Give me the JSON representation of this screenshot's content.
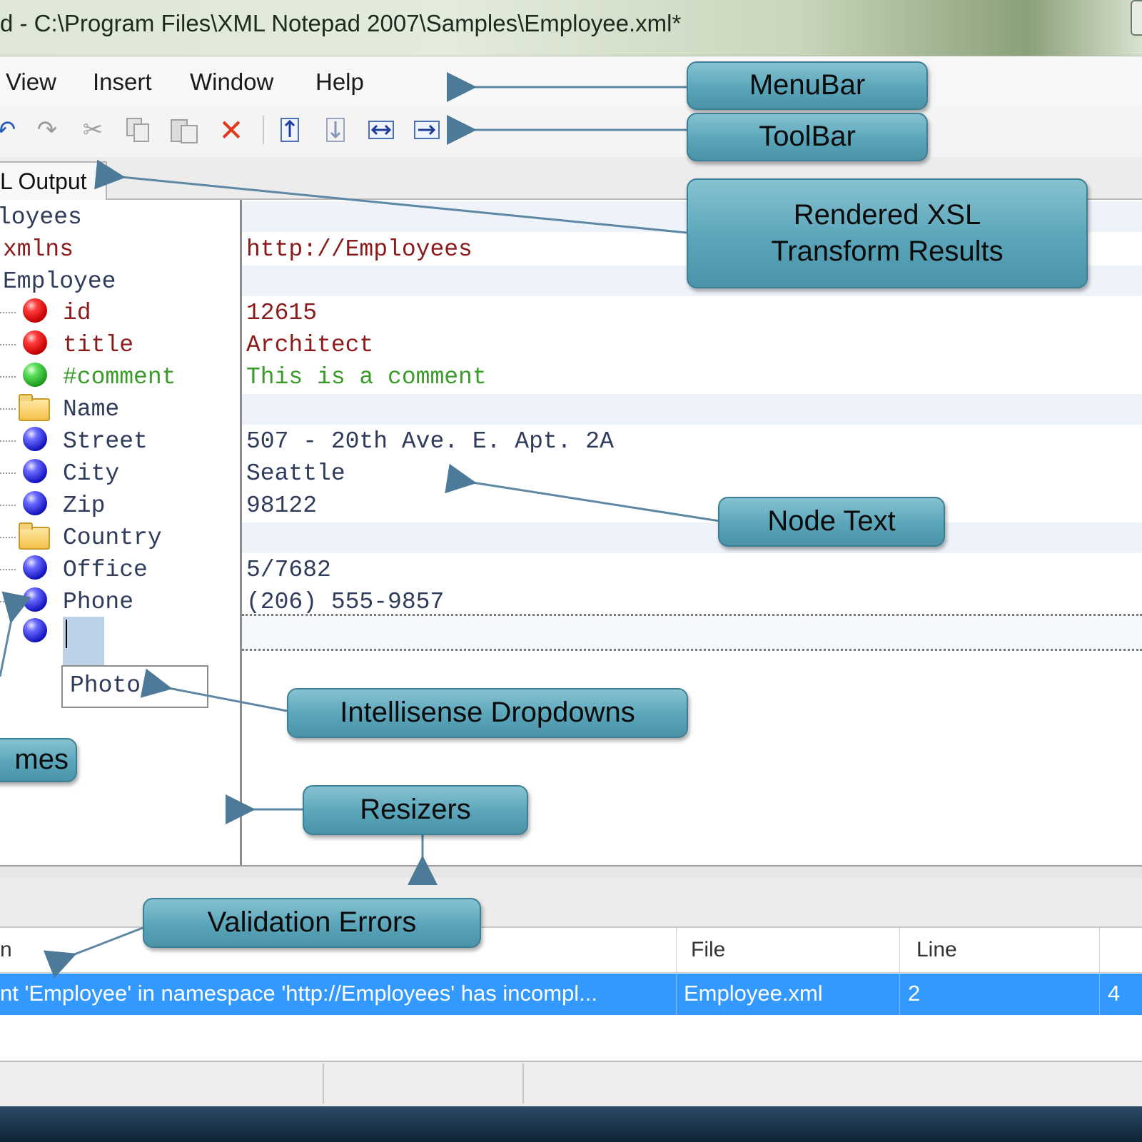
{
  "window": {
    "title": "d - C:\\Program Files\\XML Notepad 2007\\Samples\\Employee.xml*"
  },
  "menu": {
    "items": [
      "View",
      "Insert",
      "Window",
      "Help"
    ]
  },
  "toolbar": {
    "icons": [
      "undo-icon",
      "redo-icon",
      "cut-icon",
      "copy-icon",
      "paste-icon",
      "delete-icon",
      "insert-before-icon",
      "insert-after-icon",
      "insert-child-icon",
      "nudge-right-icon"
    ]
  },
  "tabs": {
    "active_label": "L Output"
  },
  "tree": {
    "nodes": [
      {
        "label": "loyees",
        "icon": ""
      },
      {
        "label": "xmlns",
        "icon": ""
      },
      {
        "label": "Employee",
        "icon": ""
      },
      {
        "label": "id",
        "icon": "attribute-icon"
      },
      {
        "label": "title",
        "icon": "attribute-icon"
      },
      {
        "label": "#comment",
        "icon": "comment-icon"
      },
      {
        "label": "Name",
        "icon": "folder-icon"
      },
      {
        "label": "Street",
        "icon": "element-icon"
      },
      {
        "label": "City",
        "icon": "element-icon"
      },
      {
        "label": "Zip",
        "icon": "element-icon"
      },
      {
        "label": "Country",
        "icon": "folder-icon"
      },
      {
        "label": "Office",
        "icon": "element-icon"
      },
      {
        "label": "Phone",
        "icon": "element-icon"
      }
    ],
    "intellisense_option": "Photo"
  },
  "node_text": {
    "lines": [
      "http://Employees",
      "12615",
      "Architect",
      "This is a comment",
      "507 - 20th Ave. E. Apt. 2A",
      "Seattle",
      "98122",
      "5/7682",
      "(206) 555-9857"
    ]
  },
  "errors": {
    "columns": [
      "n",
      "File",
      "Line"
    ],
    "rows": [
      {
        "description": "nt 'Employee' in namespace 'http://Employees' has incompl...",
        "file": "Employee.xml",
        "line": "2",
        "extra": "4"
      }
    ]
  },
  "callouts": {
    "menubar": "MenuBar",
    "toolbar": "ToolBar",
    "xsl_line1": "Rendered XSL",
    "xsl_line2": "Transform Results",
    "node_text": "Node Text",
    "intellisense": "Intellisense Dropdowns",
    "names": "mes",
    "resizers": "Resizers",
    "validation": "Validation Errors"
  },
  "colors": {
    "callout": "#5aa5ba",
    "attribute_text": "#8b1a1a",
    "comment_text": "#3a9a2a",
    "element_text": "#2f3b5a",
    "selection": "#3399ff"
  }
}
